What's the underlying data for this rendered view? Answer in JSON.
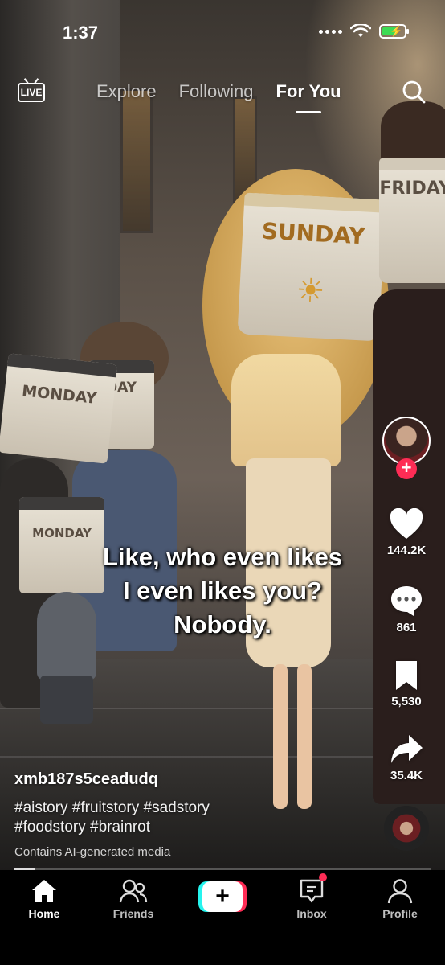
{
  "status_bar": {
    "time": "1:37"
  },
  "top_nav": {
    "live_label": "LIVE",
    "tabs": [
      {
        "label": "Explore",
        "active": false
      },
      {
        "label": "Following",
        "active": false
      },
      {
        "label": "For You",
        "active": true
      }
    ]
  },
  "video": {
    "caption_lines": [
      "Like, who even likes",
      "I even likes you?",
      "Nobody."
    ],
    "character_labels": [
      "MONDAY",
      "DAY",
      "MONDAY",
      "SUNDAY",
      "FRIDAY"
    ],
    "progress": 0.05
  },
  "rail": {
    "likes": "144.2K",
    "comments": "861",
    "saves": "5,530",
    "shares": "35.4K"
  },
  "info": {
    "username": "xmb187s5ceadudq",
    "hashtags_line1": "#aistory #fruitstory #sadstory",
    "hashtags_line2": "#foodstory #brainrot",
    "ai_label": "Contains AI-generated media"
  },
  "tabbar": {
    "home": "Home",
    "friends": "Friends",
    "create": "+",
    "inbox": "Inbox",
    "profile": "Profile"
  },
  "colors": {
    "accent_red": "#fe2c55",
    "accent_cyan": "#25f4ee",
    "battery_green": "#3ddc55"
  }
}
